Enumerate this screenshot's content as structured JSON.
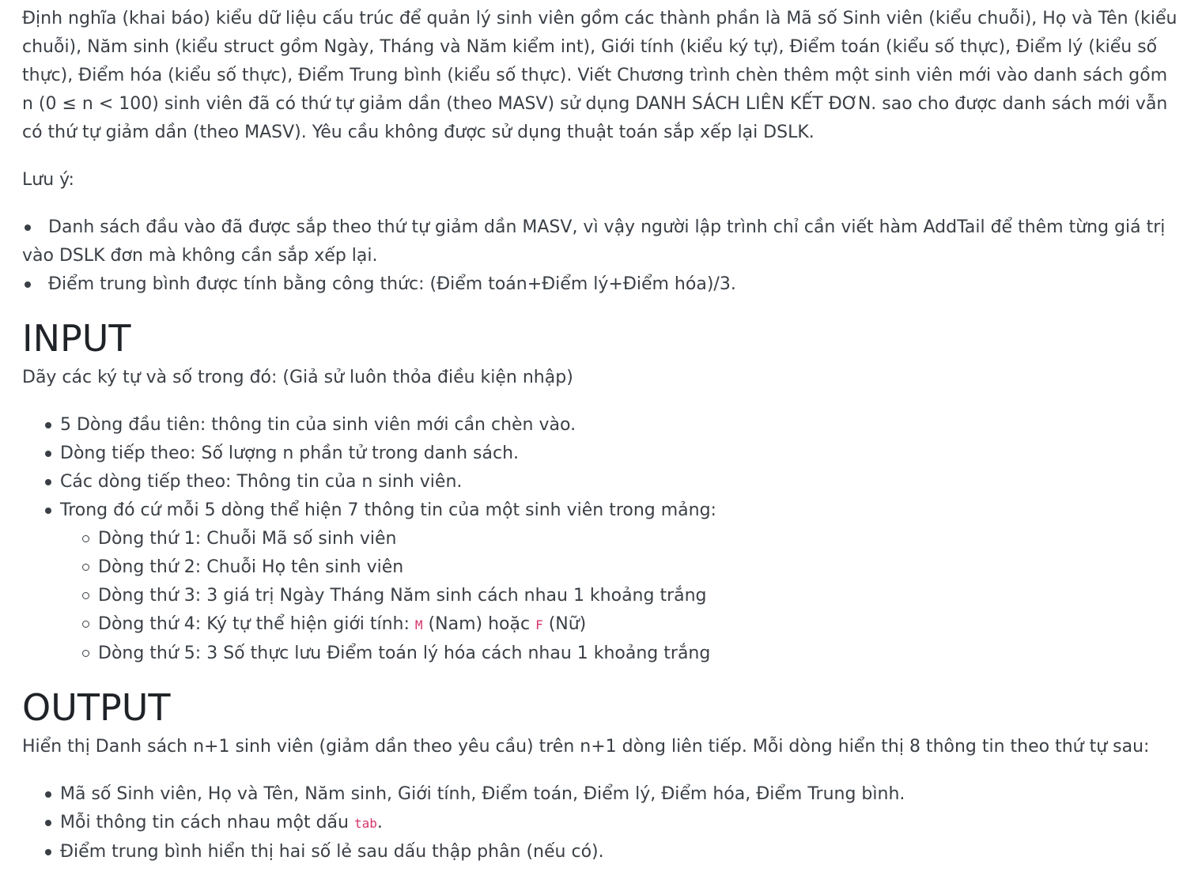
{
  "intro": "Định nghĩa (khai báo) kiểu dữ liệu cấu trúc để quản lý sinh viên gồm các thành phần là Mã số Sinh viên (kiểu chuỗi), Họ và Tên (kiểu chuỗi), Năm sinh (kiểu struct gồm Ngày, Tháng và Năm kiểm int), Giới tính (kiểu ký tự), Điểm toán (kiểu số thực), Điểm lý (kiểu số thực), Điểm hóa (kiểu số thực), Điểm Trung bình (kiểu số thực). Viết Chương trình chèn thêm một sinh viên mới vào danh sách gồm n (0 ≤ n < 100) sinh viên đã có thứ tự giảm dần (theo MASV) sử dụng DANH SÁCH LIÊN KẾT ĐƠN. sao cho được danh sách mới vẫn có thứ tự giảm dần (theo MASV). Yêu cầu không được sử dụng thuật toán sắp xếp lại DSLK.",
  "note_label": "Lưu ý:",
  "notes": [
    "Danh sách đầu vào đã được sắp theo thứ tự giảm dần MASV, vì vậy người lập trình chỉ cần viết hàm AddTail để thêm từng giá trị vào DSLK đơn mà không cần sắp xếp lại.",
    "Điểm trung bình được tính bằng công thức: (Điểm toán+Điểm lý+Điểm hóa)/3."
  ],
  "input": {
    "heading": "INPUT",
    "lead": "Dãy các ký tự và số trong đó: (Giả sử luôn thỏa điều kiện nhập)",
    "items": [
      "5 Dòng đầu tiên: thông tin của sinh viên mới cần chèn vào.",
      "Dòng tiếp theo: Số lượng n phần tử trong danh sách.",
      "Các dòng tiếp theo: Thông tin của n sinh viên.",
      "Trong đó cứ mỗi 5 dòng thể hiện 7 thông tin của một sinh viên trong mảng:"
    ],
    "sub_items": [
      "Dòng thứ 1: Chuỗi Mã số sinh viên",
      "Dòng thứ 2: Chuỗi Họ tên sinh viên",
      "Dòng thứ 3: 3 giá trị Ngày Tháng Năm sinh cách nhau 1 khoảng trắng"
    ],
    "gender_line": {
      "prefix": "Dòng thứ 4: Ký tự thể hiện giới tính: ",
      "code_m": "M",
      "middle": " (Nam) hoặc ",
      "code_f": "F",
      "suffix": " (Nữ)"
    },
    "sub_item_last": "Dòng thứ 5: 3 Số thực lưu Điểm toán lý hóa cách nhau 1 khoảng trắng"
  },
  "output": {
    "heading": "OUTPUT",
    "lead": "Hiển thị Danh sách n+1 sinh viên (giảm dần theo yêu cầu) trên n+1 dòng liên tiếp. Mỗi dòng hiển thị 8 thông tin theo thứ tự sau:",
    "item1": "Mã số Sinh viên, Họ và Tên, Năm sinh, Giới tính, Điểm toán, Điểm lý, Điểm hóa, Điểm Trung bình.",
    "item2_prefix": "Mỗi thông tin cách nhau một dấu ",
    "item2_code": "tab",
    "item2_suffix": ".",
    "item3": "Điểm trung bình hiển thị hai số lẻ sau dấu thập phân (nếu có)."
  }
}
